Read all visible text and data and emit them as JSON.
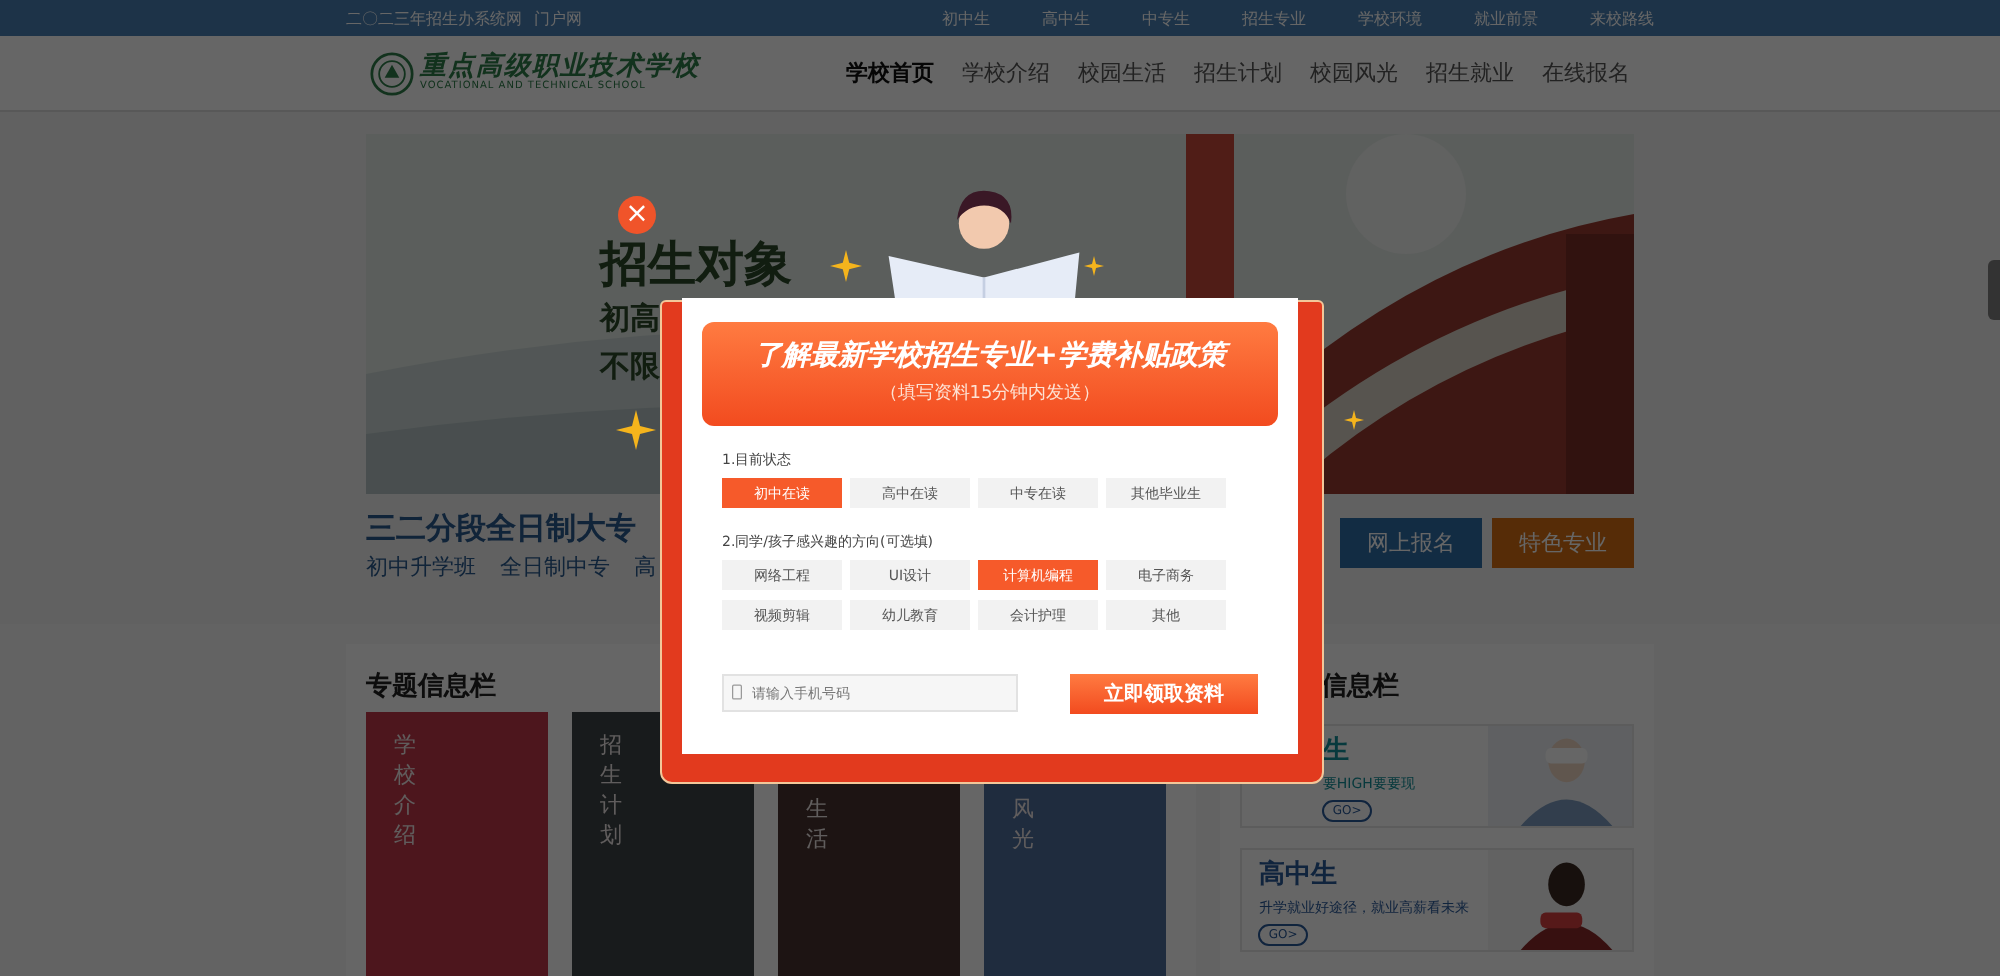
{
  "top_bar": {
    "title": "二〇二三年招生办系统网",
    "subtitle": "门户网",
    "links": [
      "初中生",
      "高中生",
      "中专生",
      "招生专业",
      "学校环境",
      "就业前景",
      "来校路线"
    ]
  },
  "header": {
    "logo": {
      "name": "重点高级职业技术学校",
      "english": "VOCATIONAL AND TECHNICAL SCHOOL"
    },
    "nav": [
      {
        "label": "学校首页",
        "selected": true
      },
      {
        "label": "学校介绍",
        "selected": false
      },
      {
        "label": "校园生活",
        "selected": false
      },
      {
        "label": "招生计划",
        "selected": false
      },
      {
        "label": "校园风光",
        "selected": false
      },
      {
        "label": "招生就业",
        "selected": false
      },
      {
        "label": "在线报名",
        "selected": false
      }
    ]
  },
  "banner": {
    "heading": "招生对象",
    "lines": [
      "初高",
      "不限"
    ]
  },
  "intro": {
    "title": "三二分段全日制大专",
    "tags": [
      "初中升学班",
      "全日制中专",
      "高"
    ],
    "buttons": [
      {
        "label": "网上报名",
        "kind": "blue"
      },
      {
        "label": "特色专业",
        "kind": "orange"
      }
    ]
  },
  "topics": {
    "title": "专题信息栏",
    "cards": [
      {
        "label": "学校介绍"
      },
      {
        "label": "招生计划"
      },
      {
        "label": "生活"
      },
      {
        "label": "风光"
      }
    ]
  },
  "info": {
    "title": "信息栏",
    "cards": [
      {
        "title": "生",
        "text": "要HIGH要要现",
        "go": "GO>"
      },
      {
        "title": "高中生",
        "text": "升学就业好途径，就业高薪看未来",
        "go": "GO>"
      }
    ]
  },
  "modal": {
    "close": "×",
    "title": "了解最新学校招生专业+学费补贴政策",
    "subtitle": "（填写资料15分钟内发送）",
    "q1": {
      "label": "1.目前状态",
      "options": [
        {
          "label": "初中在读",
          "selected": true
        },
        {
          "label": "高中在读",
          "selected": false
        },
        {
          "label": "中专在读",
          "selected": false
        },
        {
          "label": "其他毕业生",
          "selected": false
        }
      ]
    },
    "q2": {
      "label": "2.同学/孩子感兴趣的方向(可选填)",
      "options": [
        {
          "label": "网络工程",
          "selected": false
        },
        {
          "label": "UI设计",
          "selected": false
        },
        {
          "label": "计算机编程",
          "selected": true
        },
        {
          "label": "电子商务",
          "selected": false
        },
        {
          "label": "视频剪辑",
          "selected": false
        },
        {
          "label": "幼儿教育",
          "selected": false
        },
        {
          "label": "会计护理",
          "selected": false
        },
        {
          "label": "其他",
          "selected": false
        }
      ]
    },
    "phone": {
      "placeholder": "请输入手机号码"
    },
    "submit": "立即领取资料"
  }
}
